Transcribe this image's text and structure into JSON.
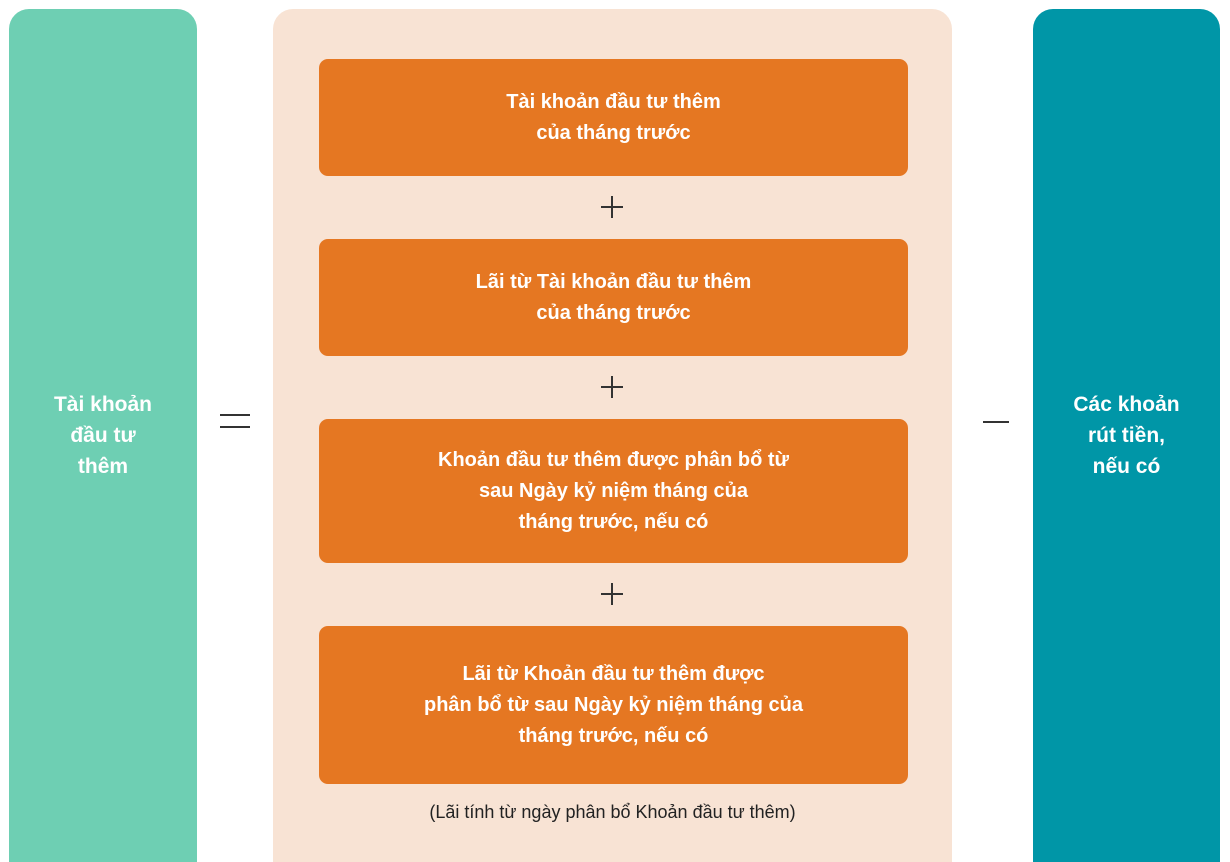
{
  "left_box": {
    "label": "Tài khoản\nđầu tư\nthêm"
  },
  "operators": {
    "equals": "=",
    "minus": "−",
    "plus": "+"
  },
  "terms": [
    {
      "label": "Tài khoản đầu tư thêm\ncủa tháng trước"
    },
    {
      "label": "Lãi từ Tài khoản đầu tư thêm\ncủa tháng trước"
    },
    {
      "label": "Khoản đầu tư thêm được phân bổ từ\nsau Ngày kỷ niệm tháng của\ntháng trước, nếu có"
    },
    {
      "label": "Lãi từ Khoản đầu tư thêm được\nphân bổ từ sau Ngày kỷ niệm tháng của\ntháng trước, nếu có"
    }
  ],
  "note": "(Lãi tính từ ngày phân bổ Khoản đầu tư thêm)",
  "right_box": {
    "label": "Các khoản\nrút tiền,\nnếu có"
  },
  "colors": {
    "left_box": "#6ecfb3",
    "right_box": "#0096a7",
    "middle_panel": "#f8e3d4",
    "term_box": "#e57722"
  }
}
